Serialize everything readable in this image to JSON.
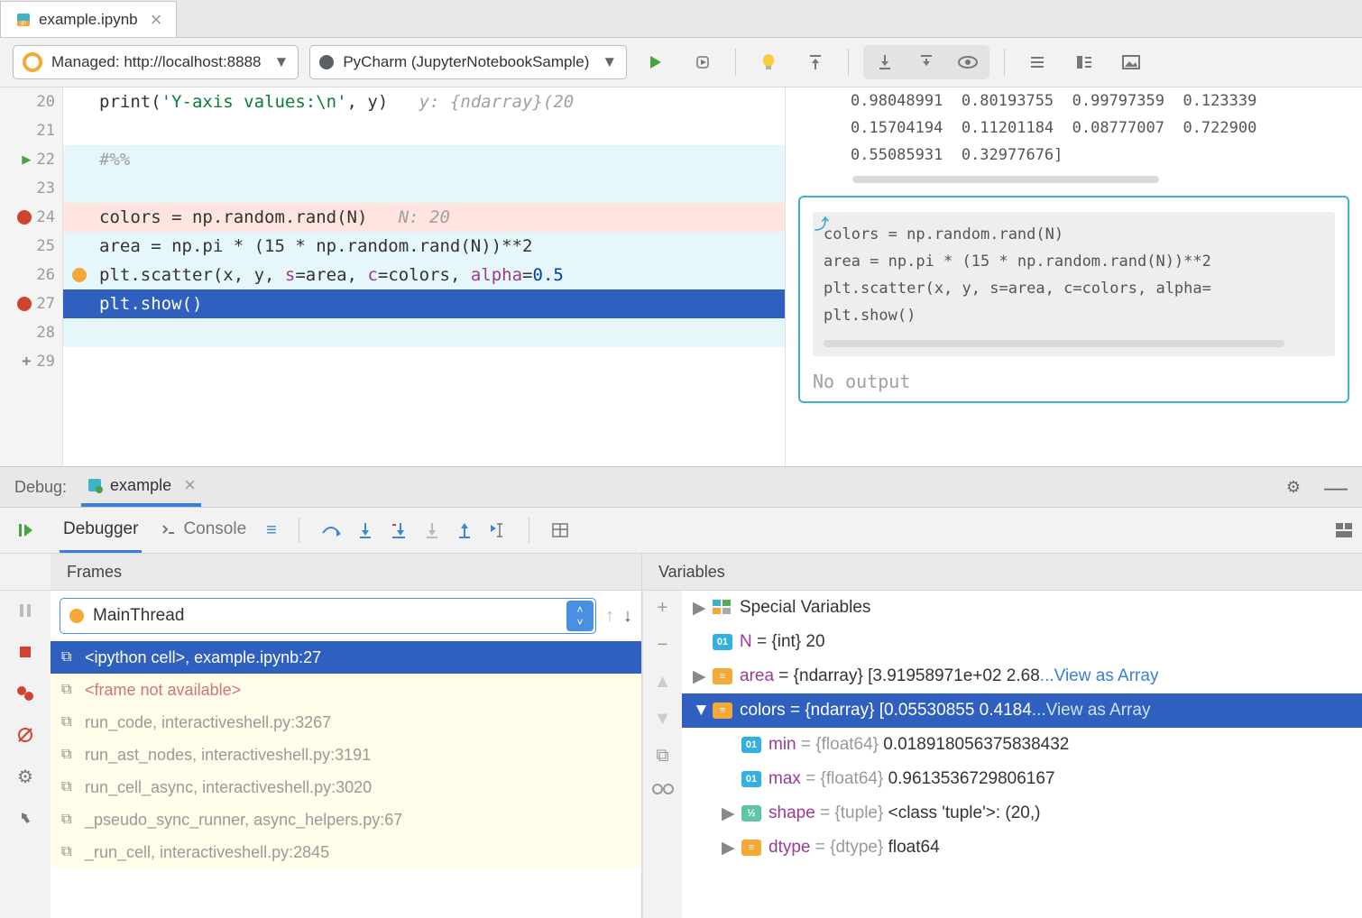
{
  "tab": {
    "name": "example.ipynb"
  },
  "toolbar": {
    "server": "Managed: http://localhost:8888",
    "kernel": "PyCharm (JupyterNotebookSample)"
  },
  "editor": {
    "lines": [
      {
        "num": "20",
        "code": "print('Y-axis values:\\n', y)",
        "hint": "y: {ndarray}(20"
      },
      {
        "num": "21",
        "code": ""
      },
      {
        "num": "22",
        "code": "#%%",
        "bg": "cyan",
        "run": true
      },
      {
        "num": "23",
        "code": "",
        "bg": "cyan"
      },
      {
        "num": "24",
        "code": "colors = np.random.rand(N)",
        "hint": "N: 20",
        "bg": "red",
        "bp": true
      },
      {
        "num": "25",
        "code": "area = np.pi * (15 * np.random.rand(N))**2",
        "bg": "cyan"
      },
      {
        "num": "26",
        "code": "plt.scatter(x, y, s=area, c=colors, alpha=0.5",
        "bg": "cyan",
        "amber": true
      },
      {
        "num": "27",
        "code": "plt.show()",
        "bg": "sel",
        "bp": true
      },
      {
        "num": "28",
        "code": "",
        "bg": "cyan"
      },
      {
        "num": "29",
        "code": "",
        "plus": true
      }
    ]
  },
  "preview": {
    "output_lines": [
      "0.98048991  0.80193755  0.99797359  0.123339",
      "0.15704194  0.11201184  0.08777007  0.722900",
      "0.55085931  0.32977676]"
    ],
    "cell_code": [
      "colors = np.random.rand(N)",
      "area = np.pi * (15 * np.random.rand(N))**2",
      "plt.scatter(x, y, s=area, c=colors, alpha=",
      "plt.show()"
    ],
    "no_output": "No output"
  },
  "debug": {
    "label": "Debug:",
    "tab": "example",
    "tabs": {
      "debugger": "Debugger",
      "console": "Console"
    },
    "frames_label": "Frames",
    "vars_label": "Variables",
    "thread": "MainThread",
    "frames": [
      {
        "text": "<ipython cell>, example.ipynb:27",
        "sel": true
      },
      {
        "text": "<frame not available>",
        "avail": true
      },
      {
        "text": "run_code, interactiveshell.py:3267"
      },
      {
        "text": "run_ast_nodes, interactiveshell.py:3191"
      },
      {
        "text": "run_cell_async, interactiveshell.py:3020"
      },
      {
        "text": "_pseudo_sync_runner, async_helpers.py:67"
      },
      {
        "text": "_run_cell, interactiveshell.py:2845"
      }
    ],
    "vars": [
      {
        "exp": "▶",
        "badge": "special",
        "name": "Special Variables",
        "value": ""
      },
      {
        "exp": "",
        "badge": "int",
        "pre": "01",
        "name": "N",
        "value": " = {int} 20"
      },
      {
        "exp": "▶",
        "badge": "arr",
        "name": "area",
        "value": " = {ndarray} [3.91958971e+02 2.68",
        "link": "...View as Array"
      },
      {
        "exp": "▼",
        "badge": "arr",
        "name": "colors",
        "value": " = {ndarray} [0.05530855 0.4184",
        "link": "...View as Array",
        "sel": true
      },
      {
        "exp": "",
        "indent": 1,
        "badge": "int",
        "pre": "01",
        "name": "min",
        "value": " = {float64} 0.018918056375838432"
      },
      {
        "exp": "",
        "indent": 1,
        "badge": "int",
        "pre": "01",
        "name": "max",
        "value": " = {float64} 0.9613536729806167"
      },
      {
        "exp": "▶",
        "indent": 1,
        "badge": "tuple",
        "name": "shape",
        "value": " = {tuple} <class 'tuple'>: (20,)"
      },
      {
        "exp": "▶",
        "indent": 1,
        "badge": "arr",
        "name": "dtype",
        "value": " = {dtype} float64"
      }
    ]
  }
}
